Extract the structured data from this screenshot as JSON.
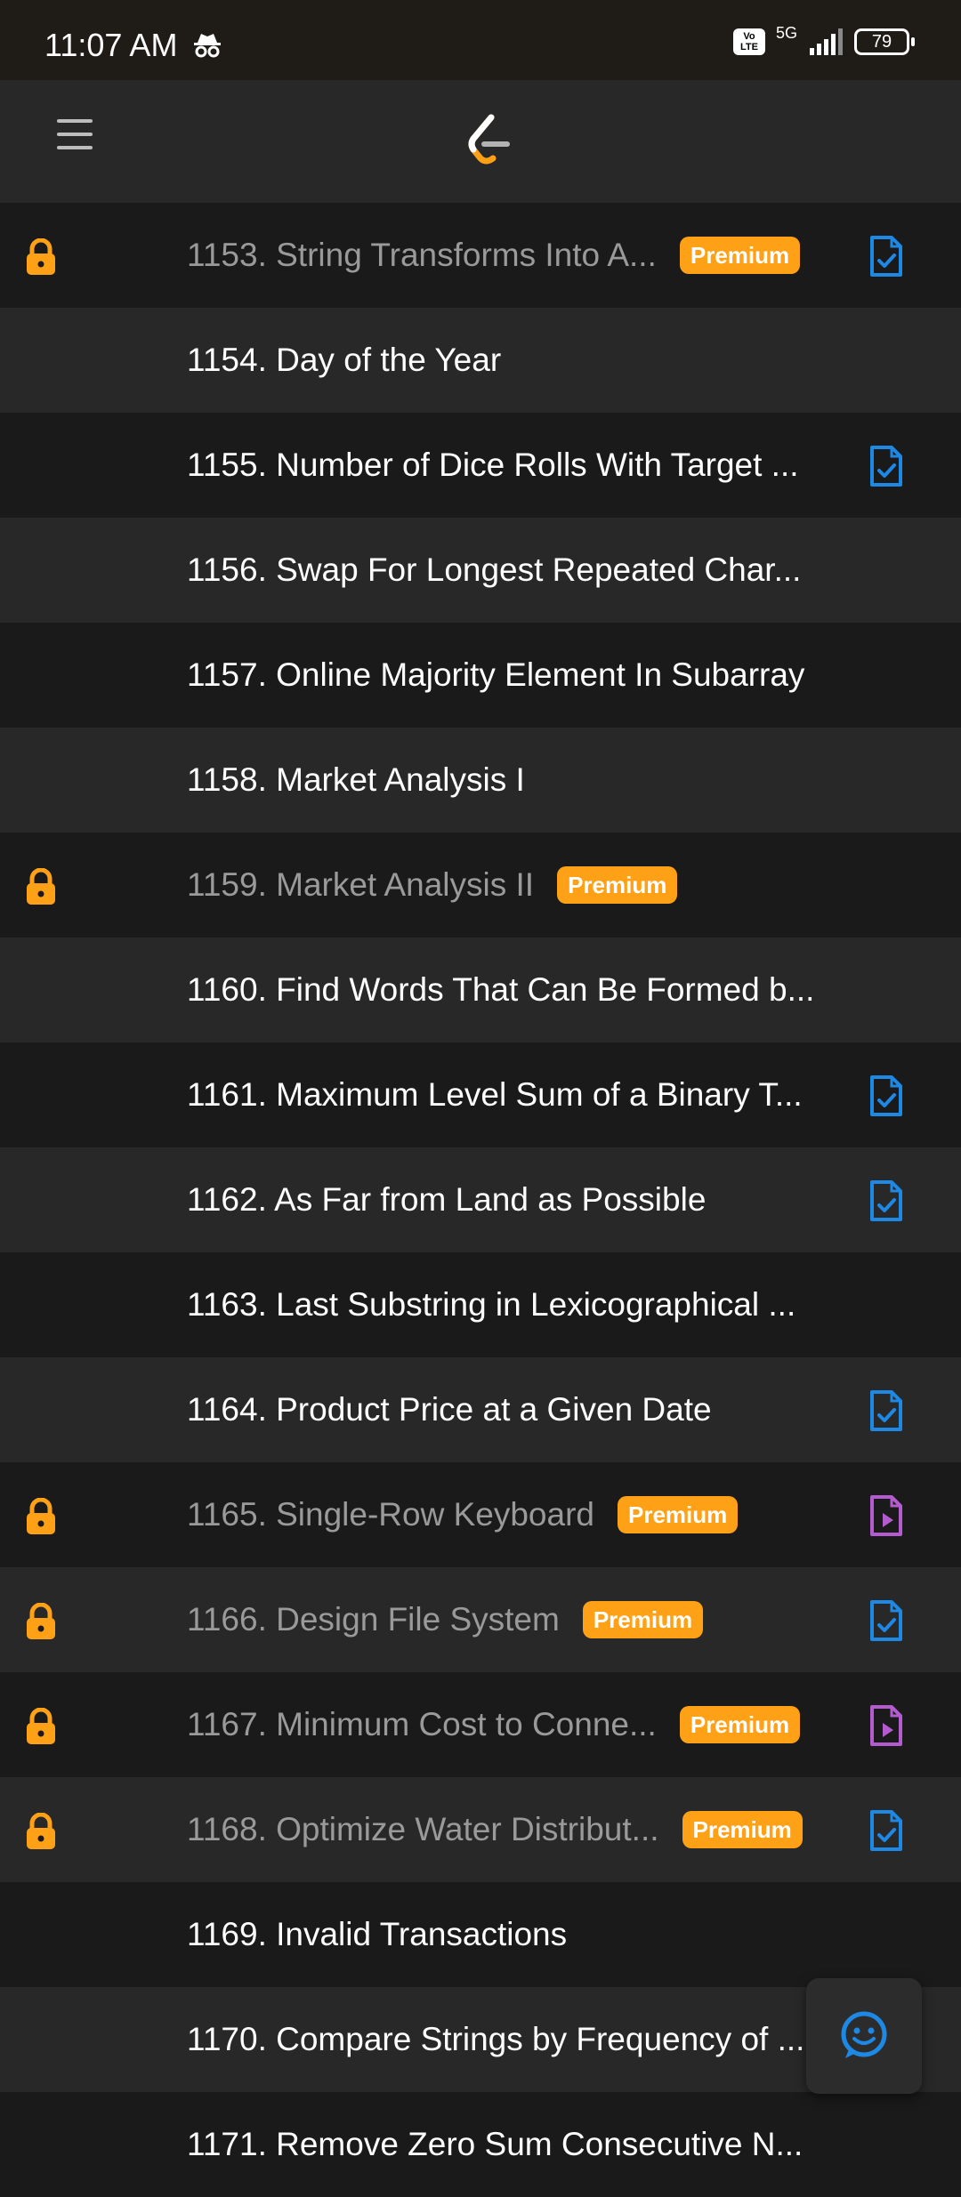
{
  "status_bar": {
    "time": "11:07 AM",
    "volte": "Vo LTE",
    "network": "5G",
    "battery": "79"
  },
  "app_bar": {
    "menu_icon": "hamburger-menu-icon",
    "logo_icon": "leetcode-logo-icon"
  },
  "colors": {
    "premium": "#ffa116",
    "solution": "#1e88e5",
    "video": "#b45ccf"
  },
  "problems": [
    {
      "title": "1153. String Transforms Into A...",
      "locked": true,
      "premium_label": "Premium",
      "icon": "solution-doc-icon"
    },
    {
      "title": "1154. Day of the Year",
      "locked": false,
      "premium_label": "",
      "icon": ""
    },
    {
      "title": "1155. Number of Dice Rolls With Target ...",
      "locked": false,
      "premium_label": "",
      "icon": "solution-doc-icon"
    },
    {
      "title": "1156. Swap For Longest Repeated Char...",
      "locked": false,
      "premium_label": "",
      "icon": ""
    },
    {
      "title": "1157. Online Majority Element In Subarray",
      "locked": false,
      "premium_label": "",
      "icon": ""
    },
    {
      "title": "1158. Market Analysis I",
      "locked": false,
      "premium_label": "",
      "icon": ""
    },
    {
      "title": "1159. Market Analysis II",
      "locked": true,
      "premium_label": "Premium",
      "icon": ""
    },
    {
      "title": "1160. Find Words That Can Be Formed b...",
      "locked": false,
      "premium_label": "",
      "icon": ""
    },
    {
      "title": "1161. Maximum Level Sum of a Binary T...",
      "locked": false,
      "premium_label": "",
      "icon": "solution-doc-icon"
    },
    {
      "title": "1162. As Far from Land as Possible",
      "locked": false,
      "premium_label": "",
      "icon": "solution-doc-icon"
    },
    {
      "title": "1163. Last Substring in Lexicographical ...",
      "locked": false,
      "premium_label": "",
      "icon": ""
    },
    {
      "title": "1164. Product Price at a Given Date",
      "locked": false,
      "premium_label": "",
      "icon": "solution-doc-icon"
    },
    {
      "title": "1165. Single-Row Keyboard",
      "locked": true,
      "premium_label": "Premium",
      "icon": "video-doc-icon"
    },
    {
      "title": "1166. Design File System",
      "locked": true,
      "premium_label": "Premium",
      "icon": "solution-doc-icon"
    },
    {
      "title": "1167. Minimum Cost to Conne...",
      "locked": true,
      "premium_label": "Premium",
      "icon": "video-doc-icon"
    },
    {
      "title": "1168. Optimize Water Distribut...",
      "locked": true,
      "premium_label": "Premium",
      "icon": "solution-doc-icon"
    },
    {
      "title": "1169. Invalid Transactions",
      "locked": false,
      "premium_label": "",
      "icon": ""
    },
    {
      "title": "1170. Compare Strings by Frequency of ...",
      "locked": false,
      "premium_label": "",
      "icon": ""
    },
    {
      "title": "1171. Remove Zero Sum Consecutive N...",
      "locked": false,
      "premium_label": "",
      "icon": ""
    }
  ],
  "fab": {
    "icon": "feedback-smiley-icon"
  }
}
